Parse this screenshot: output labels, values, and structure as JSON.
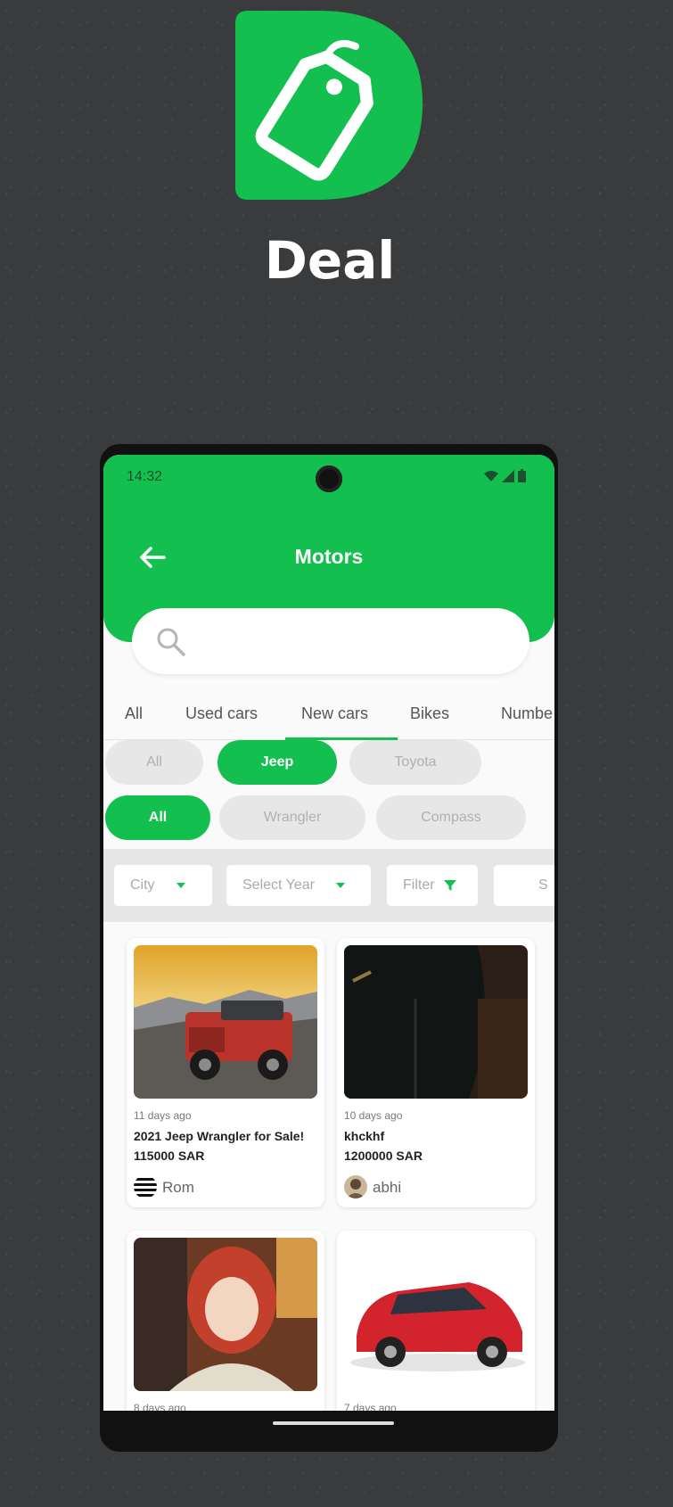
{
  "brand": {
    "name": "Deal",
    "color": "#13c04f"
  },
  "status_bar": {
    "time": "14:32"
  },
  "header": {
    "title": "Motors"
  },
  "search": {
    "placeholder": ""
  },
  "tabs": [
    {
      "label": "All"
    },
    {
      "label": "Used cars"
    },
    {
      "label": "New cars",
      "active": true
    },
    {
      "label": "Bikes"
    },
    {
      "label": "Numbe"
    }
  ],
  "brand_chips": [
    {
      "label": "All"
    },
    {
      "label": "Jeep",
      "active": true
    },
    {
      "label": "Toyota"
    }
  ],
  "model_chips": [
    {
      "label": "All",
      "active": true
    },
    {
      "label": "Wrangler"
    },
    {
      "label": "Compass"
    }
  ],
  "filters": {
    "city": "City",
    "year": "Select Year",
    "filter": "Filter",
    "sort": "S"
  },
  "listings": [
    {
      "ago": "11 days ago",
      "title": " 2021 Jeep Wrangler for Sale!",
      "price": "115000 SAR",
      "user": "Rom"
    },
    {
      "ago": "10 days ago",
      "title": "khckhf",
      "price": "1200000 SAR",
      "user": "abhi"
    },
    {
      "ago": "8 days ago",
      "title": "",
      "price": "",
      "user": ""
    },
    {
      "ago": "7 days ago",
      "title": "",
      "price": "",
      "user": ""
    }
  ]
}
